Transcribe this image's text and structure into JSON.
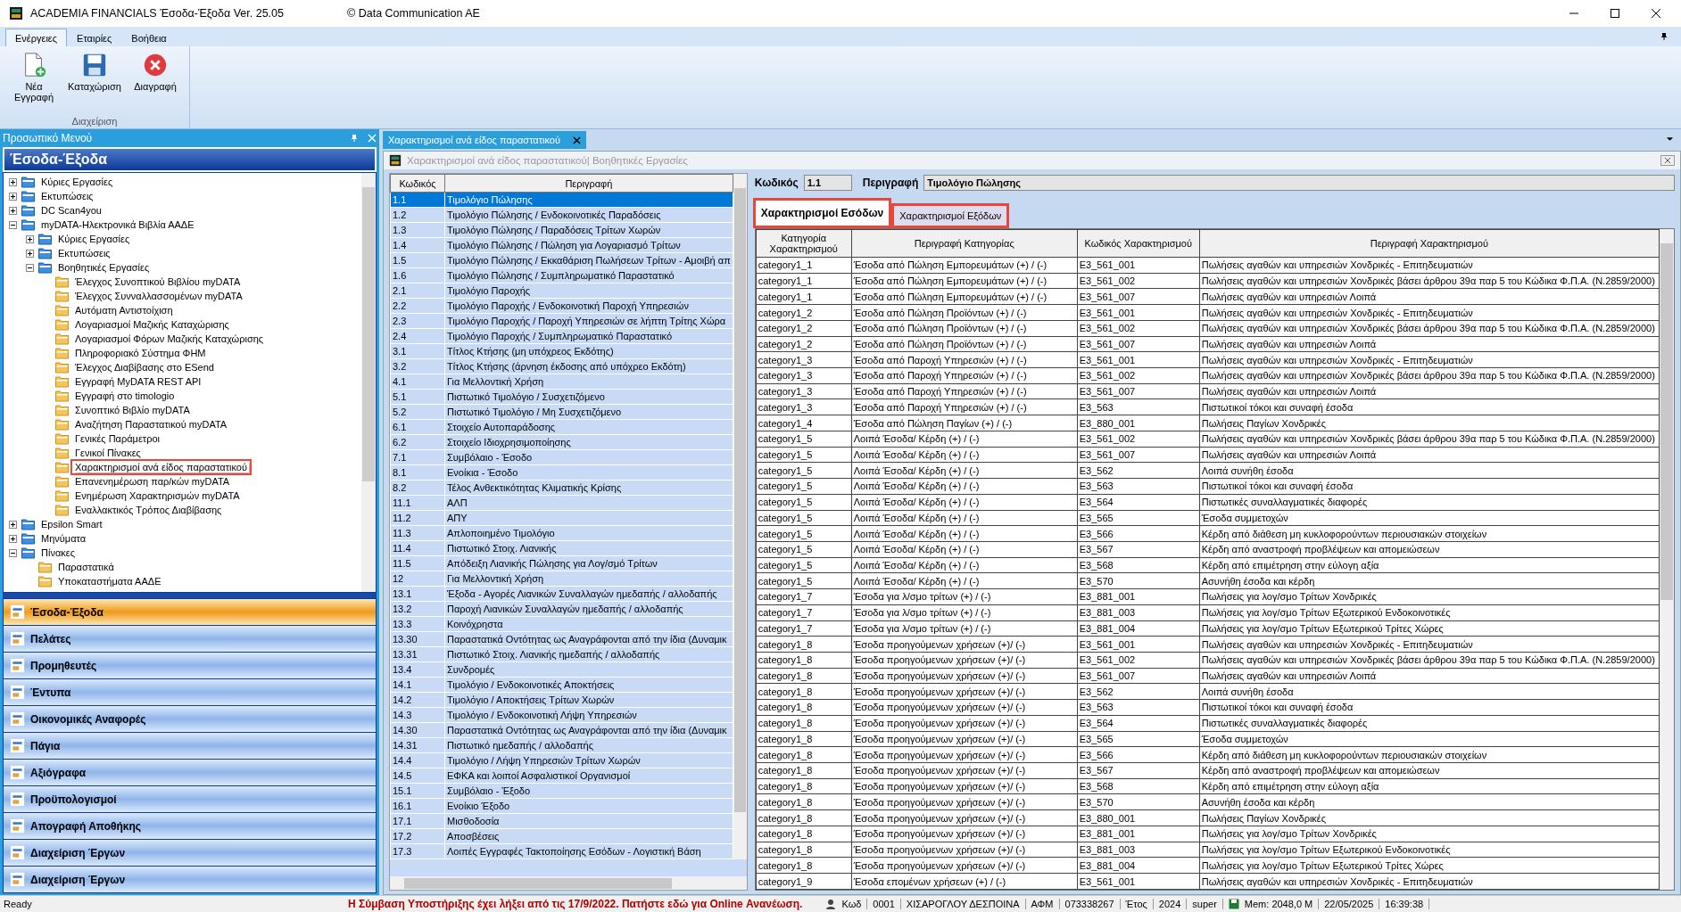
{
  "window": {
    "title": "ACADEMIA FINANCIALS Έσοδα-Έξοδα Ver. 25.05",
    "copyright": "© Data Communication AE"
  },
  "ribbon": {
    "tabs": [
      {
        "label": "Ενέργειες",
        "selected": true
      },
      {
        "label": "Εταιρίες",
        "selected": false
      },
      {
        "label": "Βοήθεια",
        "selected": false
      }
    ],
    "group": "Διαχείριση",
    "buttons": [
      {
        "kind": "new",
        "label": "Νέα Εγγραφή"
      },
      {
        "kind": "save",
        "label": "Καταχώριση"
      },
      {
        "kind": "delete",
        "label": "Διαγραφή"
      }
    ]
  },
  "side_panel": {
    "title": "Προσωπικό Μενού",
    "heading": "Έσοδα-Έξοδα",
    "tree": [
      {
        "label": "Κύριες Εργασίες",
        "expanded": false
      },
      {
        "label": "Εκτυπώσεις",
        "expanded": false
      },
      {
        "label": "DC Scan4you",
        "expanded": false
      },
      {
        "label": "myDATA-Ηλεκτρονικά Βιβλία ΑΑΔΕ",
        "expanded": true,
        "children": [
          {
            "label": "Κύριες Εργασίες",
            "expanded": false
          },
          {
            "label": "Εκτυπώσεις",
            "expanded": false
          },
          {
            "label": "Βοηθητικές Εργασίες",
            "expanded": true,
            "children": [
              {
                "label": "Έλεγχος Συνοπτικού Βιβλίου myDATA",
                "highlighted": false
              },
              {
                "label": "Έλεγχος Συνναλλασσομένων myDATA",
                "highlighted": false
              },
              {
                "label": "Αυτόματη Αντιστοίχιση",
                "highlighted": false
              },
              {
                "label": "Λογαριασμοί Μαζικής Καταχώρισης",
                "highlighted": false
              },
              {
                "label": "Λογαριασμοί Φόρων Μαζικής Καταχώρισης",
                "highlighted": false
              },
              {
                "label": "Πληροφοριακό Σύστημα ΦΗΜ",
                "highlighted": false
              },
              {
                "label": "Έλεγχος Διαβίβασης στο ESend",
                "highlighted": false
              },
              {
                "label": "Εγγραφή MyDATA REST API",
                "highlighted": false
              },
              {
                "label": "Εγγραφή στο timologio",
                "highlighted": false
              },
              {
                "label": "Συνοπτικό Βιβλίο myDATA",
                "highlighted": false
              },
              {
                "label": "Αναζήτηση Παραστατικού myDATA",
                "highlighted": false
              },
              {
                "label": "Γενικές Παράμετροι",
                "highlighted": false
              },
              {
                "label": "Γενικοί Πίνακες",
                "highlighted": false
              },
              {
                "label": "Χαρακτηρισμοί ανά είδος παραστατικού",
                "highlighted": true
              },
              {
                "label": "Επανενημέρωση παρ/κών myDATA",
                "highlighted": false
              },
              {
                "label": "Ενημέρωση Χαρακτηρισμών myDATA",
                "highlighted": false
              },
              {
                "label": "Εναλλακτικός Τρόπος Διαβίβασης",
                "highlighted": false
              }
            ]
          }
        ]
      },
      {
        "label": "Epsilon Smart",
        "expanded": false
      },
      {
        "label": "Μηνύματα",
        "expanded": false
      },
      {
        "label": "Πίνακες",
        "expanded": true,
        "children": [
          {
            "label": "Παραστατικά",
            "highlighted": false
          },
          {
            "label": "Υποκαταστήματα ΑΑΔΕ",
            "highlighted": false
          }
        ]
      }
    ],
    "modules": [
      {
        "label": "Έσοδα-Έξοδα",
        "selected": true
      },
      {
        "label": "Πελάτες",
        "selected": false
      },
      {
        "label": "Προμηθευτές",
        "selected": false
      },
      {
        "label": "Έντυπα",
        "selected": false
      },
      {
        "label": "Οικονομικές Αναφορές",
        "selected": false
      },
      {
        "label": "Πάγια",
        "selected": false
      },
      {
        "label": "Αξιόγραφα",
        "selected": false
      },
      {
        "label": "Προϋπολογισμοί",
        "selected": false
      },
      {
        "label": "Απογραφή Αποθήκης",
        "selected": false
      },
      {
        "label": "Διαχείριση Έργων",
        "selected": false
      },
      {
        "label": "Διαχείριση Έργων",
        "selected": false
      }
    ]
  },
  "document_tab": {
    "label": "Χαρακτηρισμοί ανά είδος παραστατικού"
  },
  "form": {
    "title": "Χαρακτηρισμοί ανά είδος παραστατικού| Βοηθητικές Εργασίες",
    "doc_types": {
      "columns": [
        "Κωδικός",
        "Περιγραφή"
      ],
      "rows": [
        {
          "code": "1.1",
          "description": "Τιμολόγιο Πώλησης",
          "selected": true
        },
        {
          "code": "1.2",
          "description": "Τιμολόγιο Πώλησης / Ενδοκοινοτικές Παραδόσεις",
          "selected": false
        },
        {
          "code": "1.3",
          "description": "Τιμολόγιο Πώλησης / Παραδόσεις Τρίτων Χωρών",
          "selected": false
        },
        {
          "code": "1.4",
          "description": "Τιμολόγιο Πώλησης / Πώληση για Λογαριασμό Τρίτων",
          "selected": false
        },
        {
          "code": "1.5",
          "description": "Τιμολόγιο Πώλησης / Εκκαθάριση Πωλήσεων Τρίτων - Αμοιβή απ",
          "selected": false
        },
        {
          "code": "1.6",
          "description": "Τιμολόγιο Πώλησης / Συμπληρωματικό Παραστατικό",
          "selected": false
        },
        {
          "code": "2.1",
          "description": "Τιμολόγιο Παροχής",
          "selected": false
        },
        {
          "code": "2.2",
          "description": "Τιμολόγιο Παροχής / Ενδοκοινοτική Παροχή Υπηρεσιών",
          "selected": false
        },
        {
          "code": "2.3",
          "description": "Τιμολόγιο Παροχής / Παροχή Υπηρεσιών σε λήπτη Τρίτης Χώρα",
          "selected": false
        },
        {
          "code": "2.4",
          "description": "Τιμολόγιο Παροχής / Συμπληρωματικό Παραστατικό",
          "selected": false
        },
        {
          "code": "3.1",
          "description": "Τίτλος Κτήσης (μη υπόχρεος Εκδότης)",
          "selected": false
        },
        {
          "code": "3.2",
          "description": "Τίτλος Κτήσης (άρνηση έκδοσης από υπόχρεο Εκδότη)",
          "selected": false
        },
        {
          "code": "4.1",
          "description": "Για Μελλοντική Χρήση",
          "selected": false
        },
        {
          "code": "5.1",
          "description": "Πιστωτικό Τιμολόγιο / Συσχετιζόμενο",
          "selected": false
        },
        {
          "code": "5.2",
          "description": "Πιστωτικό Τιμολόγιο / Μη Συσχετιζόμενο",
          "selected": false
        },
        {
          "code": "6.1",
          "description": "Στοιχείο Αυτοπαράδοσης",
          "selected": false
        },
        {
          "code": "6.2",
          "description": "Στοιχείο Ιδιοχρησιμοποίησης",
          "selected": false
        },
        {
          "code": "7.1",
          "description": "Συμβόλαιο - Έσοδο",
          "selected": false
        },
        {
          "code": "8.1",
          "description": "Ενοίκια - Έσοδο",
          "selected": false
        },
        {
          "code": "8.2",
          "description": "Τέλος Ανθεκτικότητας Κλιματικής Κρίσης",
          "selected": false
        },
        {
          "code": "11.1",
          "description": "ΑΛΠ",
          "selected": false
        },
        {
          "code": "11.2",
          "description": "ΑΠΥ",
          "selected": false
        },
        {
          "code": "11.3",
          "description": "Απλοποιημένο Τιμολόγιο",
          "selected": false
        },
        {
          "code": "11.4",
          "description": "Πιστωτικό Στοιχ. Λιανικής",
          "selected": false
        },
        {
          "code": "11.5",
          "description": "Απόδειξη Λιανικής Πώλησης για Λογ/σμό Τρίτων",
          "selected": false
        },
        {
          "code": "12",
          "description": "Για Μελλοντική Χρήση",
          "selected": false
        },
        {
          "code": "13.1",
          "description": "Έξοδα - Αγορές Λιανικών Συναλλαγών ημεδαπής / αλλοδαπής",
          "selected": false
        },
        {
          "code": "13.2",
          "description": "Παροχή Λιανικών Συναλλαγών ημεδαπής / αλλοδαπής",
          "selected": false
        },
        {
          "code": "13.3",
          "description": "Κοινόχρηστα",
          "selected": false
        },
        {
          "code": "13.30",
          "description": "Παραστατικά Οντότητας ως Αναγράφονται από την ίδια (Δυναμικ",
          "selected": false
        },
        {
          "code": "13.31",
          "description": "Πιστωτικό Στοιχ. Λιανικής ημεδαπής / αλλοδαπής",
          "selected": false
        },
        {
          "code": "13.4",
          "description": "Συνδρομές",
          "selected": false
        },
        {
          "code": "14.1",
          "description": "Τιμολόγιο / Ενδοκοινοτικές Αποκτήσεις",
          "selected": false
        },
        {
          "code": "14.2",
          "description": "Τιμολόγιο / Αποκτήσεις Τρίτων Χωρών",
          "selected": false
        },
        {
          "code": "14.3",
          "description": "Τιμολόγιο / Ενδοκοινοτική Λήψη Υπηρεσιών",
          "selected": false
        },
        {
          "code": "14.30",
          "description": "Παραστατικά Οντότητας ως Αναγράφονται από την ίδια (Δυναμικ",
          "selected": false
        },
        {
          "code": "14.31",
          "description": "Πιστωτικό ημεδαπής / αλλοδαπής",
          "selected": false
        },
        {
          "code": "14.4",
          "description": "Τιμολόγιο / Λήψη Υπηρεσιών Τρίτων Χωρών",
          "selected": false
        },
        {
          "code": "14.5",
          "description": "ΕΦΚΑ και λοιποί Ασφαλιστικοί Οργανισμοί",
          "selected": false
        },
        {
          "code": "15.1",
          "description": "Συμβόλαιο - Έξοδο",
          "selected": false
        },
        {
          "code": "16.1",
          "description": "Ενοίκιο Έξοδο",
          "selected": false
        },
        {
          "code": "17.1",
          "description": "Μισθοδοσία",
          "selected": false
        },
        {
          "code": "17.2",
          "description": "Αποσβέσεις",
          "selected": false
        },
        {
          "code": "17.3",
          "description": "Λοιπές Εγγραφές Τακτοποίησης Εσόδων - Λογιστική Βάση",
          "selected": false
        }
      ]
    },
    "fields": [
      {
        "label": "Κωδικός",
        "value": "1.1"
      },
      {
        "label": "Περιγραφή",
        "value": "Τιμολόγιο Πώλησης"
      }
    ],
    "tabs": [
      {
        "label": "Χαρακτηρισμοί Εσόδων",
        "selected": true,
        "highlighted": true
      },
      {
        "label": "Χαρακτηρισμοί Εξόδων",
        "selected": false,
        "highlighted": true
      }
    ],
    "table": {
      "columns": [
        "Κατηγορία Χαρακτηρισμού",
        "Περιγραφή Κατηγορίας",
        "Κωδικός Χαρακτηρισμού",
        "Περιγραφή Χαρακτηρισμού"
      ],
      "rows": [
        [
          "category1_1",
          "Έσοδα από Πώληση Εμπορευμάτων (+) / (-)",
          "E3_561_001",
          "Πωλήσεις αγαθών και υπηρεσιών Χονδρικές - Επιτηδευματιών"
        ],
        [
          "category1_1",
          "Έσοδα από Πώληση Εμπορευμάτων (+) / (-)",
          "E3_561_002",
          "Πωλήσεις αγαθών και υπηρεσιών Χονδρικές βάσει άρθρου 39α παρ 5 του Κώδικα Φ.Π.Α. (Ν.2859/2000)"
        ],
        [
          "category1_1",
          "Έσοδα από Πώληση Εμπορευμάτων (+) / (-)",
          "E3_561_007",
          "Πωλήσεις αγαθών και υπηρεσιών Λοιπά"
        ],
        [
          "category1_2",
          "Έσοδα από Πώληση Προϊόντων (+) / (-)",
          "E3_561_001",
          "Πωλήσεις αγαθών και υπηρεσιών Χονδρικές - Επιτηδευματιών"
        ],
        [
          "category1_2",
          "Έσοδα από Πώληση Προϊόντων (+) / (-)",
          "E3_561_002",
          "Πωλήσεις αγαθών και υπηρεσιών Χονδρικές βάσει άρθρου 39α παρ 5 του Κώδικα Φ.Π.Α. (Ν.2859/2000)"
        ],
        [
          "category1_2",
          "Έσοδα από Πώληση Προϊόντων (+) / (-)",
          "E3_561_007",
          "Πωλήσεις αγαθών και υπηρεσιών Λοιπά"
        ],
        [
          "category1_3",
          "Έσοδα από Παροχή Υπηρεσιών (+) / (-)",
          "E3_561_001",
          "Πωλήσεις αγαθών και υπηρεσιών Χονδρικές - Επιτηδευματιών"
        ],
        [
          "category1_3",
          "Έσοδα από Παροχή Υπηρεσιών (+) / (-)",
          "E3_561_002",
          "Πωλήσεις αγαθών και υπηρεσιών Χονδρικές βάσει άρθρου 39α παρ 5 του Κώδικα Φ.Π.Α. (Ν.2859/2000)"
        ],
        [
          "category1_3",
          "Έσοδα από Παροχή Υπηρεσιών (+) / (-)",
          "E3_561_007",
          "Πωλήσεις αγαθών και υπηρεσιών Λοιπά"
        ],
        [
          "category1_3",
          "Έσοδα από Παροχή Υπηρεσιών (+) / (-)",
          "E3_563",
          "Πιστωτικοί τόκοι και συναφή έσοδα"
        ],
        [
          "category1_4",
          "Έσοδα από Πώληση Παγίων (+) / (-)",
          "E3_880_001",
          "Πωλήσεις Παγίων Χονδρικές"
        ],
        [
          "category1_5",
          "Λοιπά Έσοδα/ Κέρδη (+) / (-)",
          "E3_561_002",
          "Πωλήσεις αγαθών και υπηρεσιών Χονδρικές βάσει άρθρου 39α παρ 5 του Κώδικα Φ.Π.Α. (Ν.2859/2000)"
        ],
        [
          "category1_5",
          "Λοιπά Έσοδα/ Κέρδη (+) / (-)",
          "E3_561_007",
          "Πωλήσεις αγαθών και υπηρεσιών Λοιπά"
        ],
        [
          "category1_5",
          "Λοιπά Έσοδα/ Κέρδη (+) / (-)",
          "E3_562",
          "Λοιπά συνήθη έσοδα"
        ],
        [
          "category1_5",
          "Λοιπά Έσοδα/ Κέρδη (+) / (-)",
          "E3_563",
          "Πιστωτικοί τόκοι και συναφή έσοδα"
        ],
        [
          "category1_5",
          "Λοιπά Έσοδα/ Κέρδη (+) / (-)",
          "E3_564",
          "Πιστωτικές συναλλαγματικές διαφορές"
        ],
        [
          "category1_5",
          "Λοιπά Έσοδα/ Κέρδη (+) / (-)",
          "E3_565",
          "Έσοδα συμμετοχών"
        ],
        [
          "category1_5",
          "Λοιπά Έσοδα/ Κέρδη (+) / (-)",
          "E3_566",
          "Κέρδη από διάθεση μη κυκλοφορούντων περιουσιακών στοιχείων"
        ],
        [
          "category1_5",
          "Λοιπά Έσοδα/ Κέρδη (+) / (-)",
          "E3_567",
          "Κέρδη από αναστροφή προβλέψεων και απομειώσεων"
        ],
        [
          "category1_5",
          "Λοιπά Έσοδα/ Κέρδη (+) / (-)",
          "E3_568",
          "Κέρδη από επιμέτρηση στην εύλογη αξία"
        ],
        [
          "category1_5",
          "Λοιπά Έσοδα/ Κέρδη (+) / (-)",
          "E3_570",
          "Ασυνήθη έσοδα και κέρδη"
        ],
        [
          "category1_7",
          "Έσοδα για λ/σμο τρίτων (+) / (-)",
          "E3_881_001",
          "Πωλήσεις για λογ/σμο Τρίτων Χονδρικές"
        ],
        [
          "category1_7",
          "Έσοδα για λ/σμο τρίτων (+) / (-)",
          "E3_881_003",
          "Πωλήσεις για λογ/σμο Τρίτων Εξωτερικού Ενδοκοινοτικές"
        ],
        [
          "category1_7",
          "Έσοδα για λ/σμο τρίτων (+) / (-)",
          "E3_881_004",
          "Πωλήσεις για λογ/σμο Τρίτων Εξωτερικού Τρίτες Χώρες"
        ],
        [
          "category1_8",
          "Έσοδα προηγούμενων χρήσεων (+)/ (-)",
          "E3_561_001",
          "Πωλήσεις αγαθών και υπηρεσιών Χονδρικές - Επιτηδευματιών"
        ],
        [
          "category1_8",
          "Έσοδα προηγούμενων χρήσεων (+)/ (-)",
          "E3_561_002",
          "Πωλήσεις αγαθών και υπηρεσιών Χονδρικές βάσει άρθρου 39α παρ 5 του Κώδικα Φ.Π.Α. (Ν.2859/2000)"
        ],
        [
          "category1_8",
          "Έσοδα προηγούμενων χρήσεων (+)/ (-)",
          "E3_561_007",
          "Πωλήσεις αγαθών και υπηρεσιών Λοιπά"
        ],
        [
          "category1_8",
          "Έσοδα προηγούμενων χρήσεων (+)/ (-)",
          "E3_562",
          "Λοιπά συνήθη έσοδα"
        ],
        [
          "category1_8",
          "Έσοδα προηγούμενων χρήσεων (+)/ (-)",
          "E3_563",
          "Πιστωτικοί τόκοι και συναφή έσοδα"
        ],
        [
          "category1_8",
          "Έσοδα προηγούμενων χρήσεων (+)/ (-)",
          "E3_564",
          "Πιστωτικές συναλλαγματικές διαφορές"
        ],
        [
          "category1_8",
          "Έσοδα προηγούμενων χρήσεων (+)/ (-)",
          "E3_565",
          "Έσοδα συμμετοχών"
        ],
        [
          "category1_8",
          "Έσοδα προηγούμενων χρήσεων (+)/ (-)",
          "E3_566",
          "Κέρδη από διάθεση μη κυκλοφορούντων περιουσιακών στοιχείων"
        ],
        [
          "category1_8",
          "Έσοδα προηγούμενων χρήσεων (+)/ (-)",
          "E3_567",
          "Κέρδη από αναστροφή προβλέψεων και απομειώσεων"
        ],
        [
          "category1_8",
          "Έσοδα προηγούμενων χρήσεων (+)/ (-)",
          "E3_568",
          "Κέρδη από επιμέτρηση στην εύλογη αξία"
        ],
        [
          "category1_8",
          "Έσοδα προηγούμενων χρήσεων (+)/ (-)",
          "E3_570",
          "Ασυνήθη έσοδα και κέρδη"
        ],
        [
          "category1_8",
          "Έσοδα προηγούμενων χρήσεων (+)/ (-)",
          "E3_880_001",
          "Πωλήσεις Παγίων Χονδρικές"
        ],
        [
          "category1_8",
          "Έσοδα προηγούμενων χρήσεων (+)/ (-)",
          "E3_881_001",
          "Πωλήσεις για λογ/σμο Τρίτων Χονδρικές"
        ],
        [
          "category1_8",
          "Έσοδα προηγούμενων χρήσεων (+)/ (-)",
          "E3_881_003",
          "Πωλήσεις για λογ/σμο Τρίτων Εξωτερικού Ενδοκοινοτικές"
        ],
        [
          "category1_8",
          "Έσοδα προηγούμενων χρήσεων (+)/ (-)",
          "E3_881_004",
          "Πωλήσεις για λογ/σμο Τρίτων Εξωτερικού Τρίτες Χώρες"
        ],
        [
          "category1_9",
          "Έσοδα επομένων χρήσεων (+) / (-)",
          "E3_561_001",
          "Πωλήσεις αγαθών και υπηρεσιών Χονδρικές - Επιτηδευματιών"
        ]
      ]
    }
  },
  "status_bar": {
    "ready": "Ready",
    "warning": "Η Σύμβαση Υποστήριξης έχει λήξει από τις 17/9/2022. Πατήστε εδώ για Online Ανανέωση.",
    "cells": [
      {
        "kind": "user",
        "text": "Κωδ"
      },
      {
        "kind": "plain",
        "text": "0001"
      },
      {
        "kind": "plain",
        "text": "ΧΙΣΑΡΟΓΛΟΥ  ΔΕΣΠΟΙΝΑ"
      },
      {
        "kind": "plain",
        "text": "ΑΦΜ"
      },
      {
        "kind": "plain",
        "text": "073338267"
      },
      {
        "kind": "plain",
        "text": "Έτος"
      },
      {
        "kind": "plain",
        "text": "2024"
      },
      {
        "kind": "plain",
        "text": "super"
      },
      {
        "kind": "disk",
        "text": "Mem: 2048,0 M"
      },
      {
        "kind": "plain",
        "text": "22/05/2025"
      },
      {
        "kind": "plain",
        "text": "16:39:38"
      }
    ]
  }
}
